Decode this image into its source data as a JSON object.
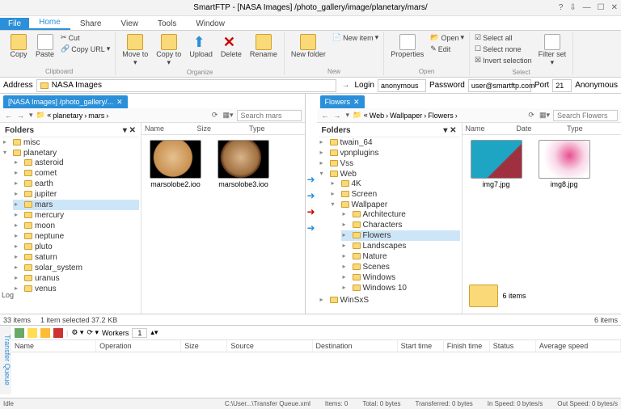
{
  "title": "SmartFTP - [NASA Images] /photo_gallery/image/planetary/mars/",
  "titlebuttons": {
    "help": "?",
    "down": "⇩",
    "min": "—",
    "max": "☐",
    "close": "✕"
  },
  "menus": {
    "file": "File",
    "home": "Home",
    "share": "Share",
    "view": "View",
    "tools": "Tools",
    "window": "Window"
  },
  "ribbon": {
    "clipboard": {
      "copy": "Copy",
      "paste": "Paste",
      "cut": "Cut",
      "copyurl": "Copy URL",
      "group": "Clipboard"
    },
    "organize": {
      "moveto": "Move to",
      "copyto": "Copy to",
      "upload": "Upload",
      "delete": "Delete",
      "rename": "Rename",
      "group": "Organize"
    },
    "new": {
      "newfolder": "New folder",
      "newitem": "New item",
      "group": "New"
    },
    "open": {
      "properties": "Properties",
      "open": "Open",
      "edit": "Edit",
      "group": "Open"
    },
    "select": {
      "selectall": "Select all",
      "selectnone": "Select none",
      "invert": "Invert selection",
      "filterset": "Filter set",
      "group": "Select"
    }
  },
  "addressbar": {
    "label": "Address",
    "value": "NASA Images",
    "login": "Login",
    "loginval": "anonymous",
    "password": "Password",
    "passval": "user@smartftp.com",
    "port": "Port",
    "portval": "21",
    "anon": "Anonymous"
  },
  "leftpane": {
    "tab": "[NASA Images] /photo_gallery/...",
    "crumbs": [
      "planetary",
      "mars"
    ],
    "searchph": "Search mars",
    "hdr": {
      "folders": "Folders",
      "name": "Name",
      "size": "Size",
      "type": "Type"
    },
    "tree": [
      "misc",
      "planetary",
      "asteroid",
      "comet",
      "earth",
      "jupiter",
      "mars",
      "mercury",
      "moon",
      "neptune",
      "pluto",
      "saturn",
      "solar_system",
      "uranus",
      "venus"
    ],
    "files": [
      {
        "name": "marsolobe2.ioo"
      },
      {
        "name": "marsolobe3.ioo"
      }
    ],
    "status1": "33 items",
    "status2": "1 item selected  37.2 KB"
  },
  "rightpane": {
    "tab": "Flowers",
    "crumbs": [
      "Web",
      "Wallpaper",
      "Flowers"
    ],
    "searchph": "Search Flowers",
    "hdr": {
      "folders": "Folders",
      "name": "Name",
      "date": "Date",
      "type": "Type"
    },
    "tree": [
      "twain_64",
      "vpnplugins",
      "Vss",
      "Web",
      "4K",
      "Screen",
      "Wallpaper",
      "Architecture",
      "Characters",
      "Flowers",
      "Landscapes",
      "Nature",
      "Scenes",
      "Windows",
      "Windows 10",
      "WinSxS"
    ],
    "files": [
      {
        "name": "img7.jpg"
      },
      {
        "name": "img8.jpg"
      }
    ],
    "summary": "6 items",
    "status": "6 items"
  },
  "log": "Log",
  "queue": {
    "side": "Transfer Queue",
    "workers": "Workers",
    "workersval": "1",
    "cols": {
      "name": "Name",
      "operation": "Operation",
      "size": "Size",
      "source": "Source",
      "destination": "Destination",
      "start": "Start time",
      "finish": "Finish time",
      "status": "Status",
      "avg": "Average speed"
    }
  },
  "bottom": {
    "idle": "Idle",
    "path": "C:\\User...\\Transfer Queue.xml",
    "items": "Items: 0",
    "total": "Total: 0 bytes",
    "transferred": "Transferred: 0 bytes",
    "inspeed": "In Speed: 0 bytes/s",
    "outspeed": "Out Speed: 0 bytes/s"
  }
}
